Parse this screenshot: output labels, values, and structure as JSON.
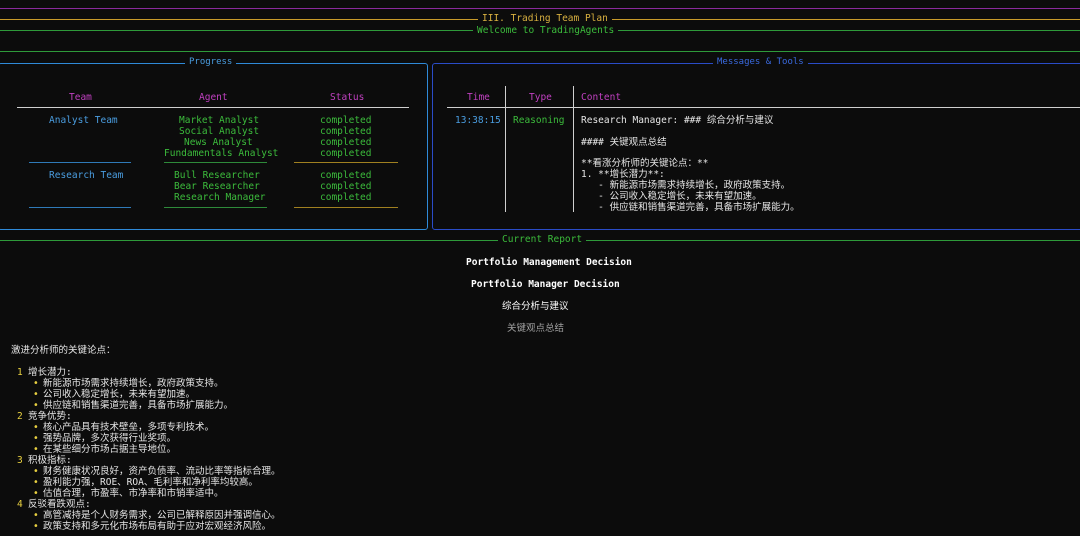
{
  "header": {
    "section": "III. Trading Team Plan",
    "welcome": "Welcome to TradingAgents"
  },
  "progress": {
    "title": "Progress",
    "columns": [
      "Team",
      "Agent",
      "Status"
    ],
    "teams": [
      {
        "name": "Analyst Team",
        "agents": [
          {
            "agent": "Market Analyst",
            "status": "completed"
          },
          {
            "agent": "Social Analyst",
            "status": "completed"
          },
          {
            "agent": "News Analyst",
            "status": "completed"
          },
          {
            "agent": "Fundamentals Analyst",
            "status": "completed"
          }
        ]
      },
      {
        "name": "Research Team",
        "agents": [
          {
            "agent": "Bull Researcher",
            "status": "completed"
          },
          {
            "agent": "Bear Researcher",
            "status": "completed"
          },
          {
            "agent": "Research Manager",
            "status": "completed"
          }
        ]
      }
    ]
  },
  "messages": {
    "title": "Messages & Tools",
    "columns": [
      "Time",
      "Type",
      "Content"
    ],
    "row": {
      "time": "13:38:15",
      "type": "Reasoning",
      "content": [
        "Research Manager: ### 综合分析与建议",
        "",
        "#### 关键观点总结",
        "",
        "**看涨分析师的关键论点：**",
        "1. **增长潜力**:",
        "   - 新能源市场需求持续增长，政府政策支持。",
        "   - 公司收入稳定增长，未来有望加速。",
        "   - 供应链和销售渠道完善，具备市场扩展能力。"
      ]
    }
  },
  "report": {
    "title": "Current Report",
    "h1": "Portfolio Management Decision",
    "h2": "Portfolio Manager Decision",
    "h3": "综合分析与建议",
    "h4": "关键观点总结",
    "intro": "激进分析师的关键论点：",
    "sections": [
      {
        "num": "1",
        "heading": "增长潜力:",
        "bullets": [
          "新能源市场需求持续增长，政府政策支持。",
          "公司收入稳定增长，未来有望加速。",
          "供应链和销售渠道完善，具备市场扩展能力。"
        ]
      },
      {
        "num": "2",
        "heading": "竞争优势:",
        "bullets": [
          "核心产品具有技术壁垒，多项专利技术。",
          "强势品牌，多次获得行业奖项。",
          "在某些细分市场占据主导地位。"
        ]
      },
      {
        "num": "3",
        "heading": "积极指标:",
        "bullets": [
          "财务健康状况良好，资产负债率、流动比率等指标合理。",
          "盈利能力强，ROE、ROA、毛利率和净利率均较高。",
          "估值合理，市盈率、市净率和市销率适中。"
        ]
      },
      {
        "num": "4",
        "heading": "反驳看跌观点:",
        "bullets": [
          "高管减持是个人财务需求，公司已解释原因并强调信心。",
          "政策支持和多元化市场布局有助于应对宏观经济风险。"
        ]
      }
    ]
  },
  "colors": {
    "purple": "#8a2a9c",
    "orange": "#c89a2a",
    "green": "#2e9a3a",
    "blue": "#4a9de0",
    "panel_blue": "#2a5cc8"
  }
}
